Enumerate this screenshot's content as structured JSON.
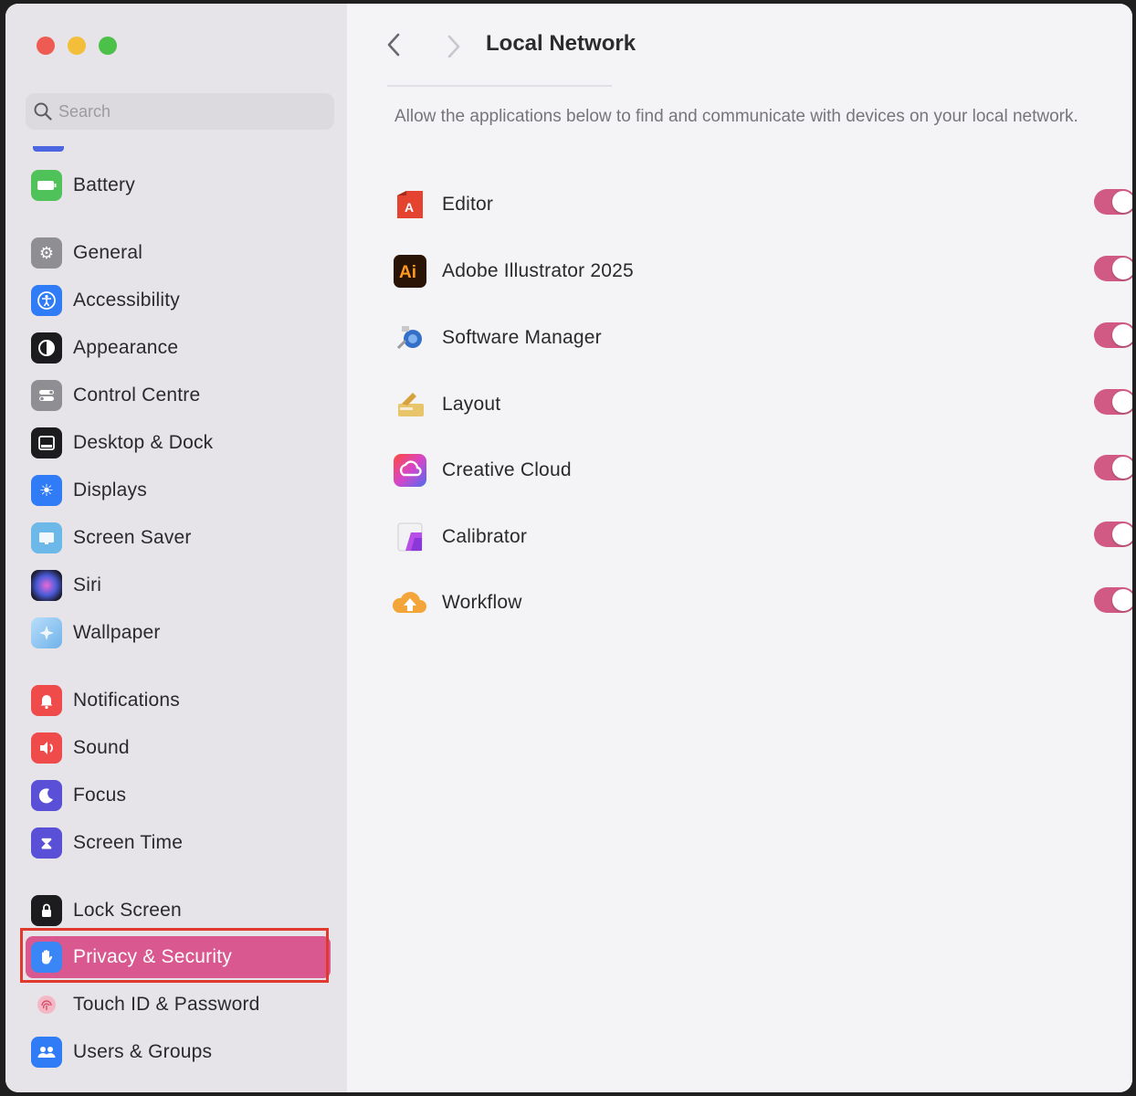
{
  "window": {
    "title": "Local Network"
  },
  "search": {
    "placeholder": "Search"
  },
  "sidebar": {
    "items": [
      {
        "id": "battery",
        "label": "Battery",
        "icon": "battery-icon",
        "color": "#4fc35a"
      },
      {
        "id": "general",
        "label": "General",
        "icon": "gear-icon",
        "color": "#8e8e93"
      },
      {
        "id": "accessibility",
        "label": "Accessibility",
        "icon": "accessibility-icon",
        "color": "#2f7cf6"
      },
      {
        "id": "appearance",
        "label": "Appearance",
        "icon": "appearance-icon",
        "color": "#1c1c1e"
      },
      {
        "id": "control-centre",
        "label": "Control Centre",
        "icon": "control-centre-icon",
        "color": "#8e8e93"
      },
      {
        "id": "desktop-dock",
        "label": "Desktop & Dock",
        "icon": "dock-icon",
        "color": "#1c1c1e"
      },
      {
        "id": "displays",
        "label": "Displays",
        "icon": "sun-icon",
        "color": "#2f7cf6"
      },
      {
        "id": "screen-saver",
        "label": "Screen Saver",
        "icon": "screen-saver-icon",
        "color": "#6cb8e8"
      },
      {
        "id": "siri",
        "label": "Siri",
        "icon": "siri-icon",
        "color": "#2a2a40"
      },
      {
        "id": "wallpaper",
        "label": "Wallpaper",
        "icon": "wallpaper-icon",
        "color": "#86c4f0"
      },
      {
        "id": "notifications",
        "label": "Notifications",
        "icon": "bell-icon",
        "color": "#ef4b4b"
      },
      {
        "id": "sound",
        "label": "Sound",
        "icon": "speaker-icon",
        "color": "#ef4b4b"
      },
      {
        "id": "focus",
        "label": "Focus",
        "icon": "moon-icon",
        "color": "#5a50d8"
      },
      {
        "id": "screen-time",
        "label": "Screen Time",
        "icon": "hourglass-icon",
        "color": "#5a50d8"
      },
      {
        "id": "lock-screen",
        "label": "Lock Screen",
        "icon": "lock-icon",
        "color": "#1c1c1e"
      },
      {
        "id": "privacy-security",
        "label": "Privacy & Security",
        "icon": "hand-icon",
        "color": "#3a86f6",
        "selected": true
      },
      {
        "id": "touch-id",
        "label": "Touch ID & Password",
        "icon": "fingerprint-icon",
        "color": "#e97a8c"
      },
      {
        "id": "users-groups",
        "label": "Users & Groups",
        "icon": "users-icon",
        "color": "#2f7cf6"
      }
    ]
  },
  "main": {
    "description": "Allow the applications below to find and communicate with devices on your local network.",
    "apps": [
      {
        "name": "Editor",
        "icon": "editor-icon",
        "enabled": true
      },
      {
        "name": "Adobe Illustrator 2025",
        "icon": "illustrator-icon",
        "enabled": true
      },
      {
        "name": "Software Manager",
        "icon": "software-manager-icon",
        "enabled": true
      },
      {
        "name": "Layout",
        "icon": "layout-icon",
        "enabled": true
      },
      {
        "name": "Creative Cloud",
        "icon": "creative-cloud-icon",
        "enabled": true
      },
      {
        "name": "Calibrator",
        "icon": "calibrator-icon",
        "enabled": true
      },
      {
        "name": "Workflow",
        "icon": "workflow-icon",
        "enabled": true
      }
    ],
    "accent_color": "#d05a84"
  }
}
